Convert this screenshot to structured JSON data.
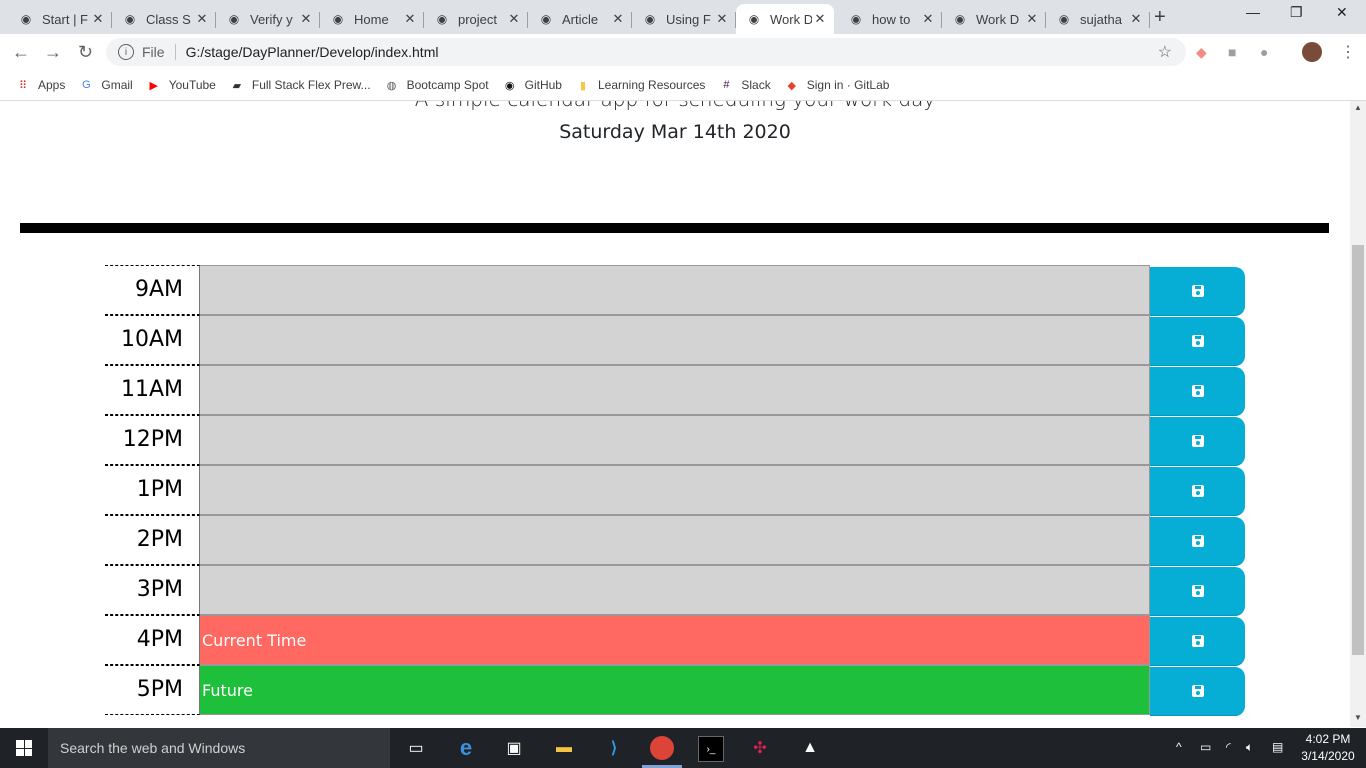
{
  "browser": {
    "tabs": [
      {
        "title": "Start | F",
        "icon": "flag-icon",
        "active": false
      },
      {
        "title": "Class S",
        "icon": "globe-icon",
        "active": false
      },
      {
        "title": "Verify y",
        "icon": "gmail-icon",
        "active": false
      },
      {
        "title": "Home",
        "icon": "nyt-icon",
        "active": false
      },
      {
        "title": "project",
        "icon": "nyt-icon",
        "active": false
      },
      {
        "title": "Article",
        "icon": "nyt-icon",
        "active": false
      },
      {
        "title": "Using F",
        "icon": "graduation-icon",
        "active": false
      },
      {
        "title": "Work D",
        "icon": "globe-icon",
        "active": true
      },
      {
        "title": "how to",
        "icon": "google-icon",
        "active": false
      },
      {
        "title": "Work D",
        "icon": "globe-icon",
        "active": false
      },
      {
        "title": "sujatha",
        "icon": "github-icon",
        "active": false
      }
    ],
    "new_tab": "+",
    "close_glyph": "✕",
    "address": {
      "scheme_label": "File",
      "url": "G:/stage/DayPlanner/Develop/index.html"
    },
    "bookmarks": [
      {
        "label": "Apps",
        "icon": "apps-grid-icon"
      },
      {
        "label": "Gmail",
        "icon": "google-icon"
      },
      {
        "label": "YouTube",
        "icon": "youtube-icon"
      },
      {
        "label": "Full Stack Flex Prew...",
        "icon": "book-icon"
      },
      {
        "label": "Bootcamp Spot",
        "icon": "globe-icon"
      },
      {
        "label": "GitHub",
        "icon": "github-icon"
      },
      {
        "label": "Learning Resources",
        "icon": "folder-icon"
      },
      {
        "label": "Slack",
        "icon": "slack-icon"
      },
      {
        "label": "Sign in · GitLab",
        "icon": "gitlab-icon"
      }
    ]
  },
  "page": {
    "lead": "A simple calendar app for scheduling your work day",
    "current_date": "Saturday Mar 14th 2020",
    "time_blocks": [
      {
        "hour": "9AM",
        "text": "",
        "status": "past"
      },
      {
        "hour": "10AM",
        "text": "",
        "status": "past"
      },
      {
        "hour": "11AM",
        "text": "",
        "status": "past"
      },
      {
        "hour": "12PM",
        "text": "",
        "status": "past"
      },
      {
        "hour": "1PM",
        "text": "",
        "status": "past"
      },
      {
        "hour": "2PM",
        "text": "",
        "status": "past"
      },
      {
        "hour": "3PM",
        "text": "",
        "status": "past"
      },
      {
        "hour": "4PM",
        "text": "Current Time",
        "status": "present"
      },
      {
        "hour": "5PM",
        "text": "Future",
        "status": "future"
      }
    ],
    "colors": {
      "past": "#d3d3d3",
      "present": "#ff6961",
      "future": "#1ebf3b",
      "save_button": "#06aed5"
    }
  },
  "taskbar": {
    "search_placeholder": "Search the web and Windows",
    "time": "4:02 PM",
    "date": "3/14/2020"
  }
}
